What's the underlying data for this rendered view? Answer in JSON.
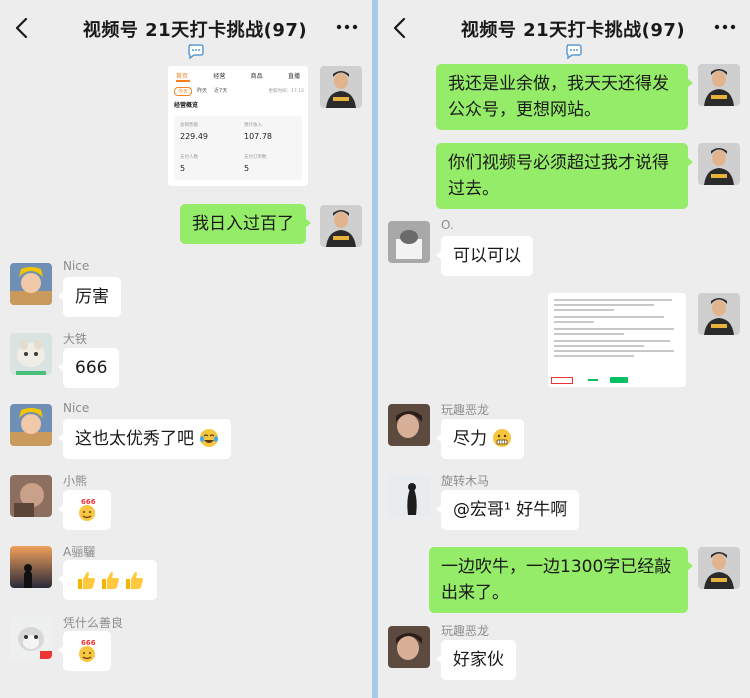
{
  "left_panel": {
    "header": {
      "title": "视频号 21天打卡挑战(97)"
    },
    "dashboard_card": {
      "tabs": [
        "首页",
        "经营",
        "商品",
        "直播"
      ],
      "filters": [
        "今天",
        "昨天",
        "近7天"
      ],
      "update_label": "更新时间：17:12",
      "section_title": "经营概览",
      "metrics": [
        {
          "label": "总销售额",
          "value": "229.49"
        },
        {
          "label": "预计收入",
          "value": "107.78"
        },
        {
          "label": "支付人数",
          "value": "5"
        },
        {
          "label": "支付订单数",
          "value": "5"
        }
      ]
    },
    "messages": [
      {
        "type": "out",
        "text": "我日入过百了"
      },
      {
        "type": "in",
        "nick": "Nice",
        "text": "厉害"
      },
      {
        "type": "in",
        "nick": "大铁",
        "text": "666"
      },
      {
        "type": "in",
        "nick": "Nice",
        "text": "这也太优秀了吧"
      },
      {
        "type": "in",
        "nick": "小熊",
        "text": ""
      },
      {
        "type": "in",
        "nick": "A骊驪",
        "text": ""
      },
      {
        "type": "in",
        "nick": "凭什么善良",
        "text": ""
      }
    ]
  },
  "right_panel": {
    "header": {
      "title": "视频号 21天打卡挑战(97)"
    },
    "messages": [
      {
        "type": "out",
        "text": "我还是业余做，我天天还得发公众号，更想网站。"
      },
      {
        "type": "out",
        "text": "你们视频号必须超过我才说得过去。"
      },
      {
        "type": "in",
        "nick": "O.",
        "text": "可以可以"
      },
      {
        "type": "in",
        "nick": "玩趣恶龙",
        "text": "尽力"
      },
      {
        "type": "in",
        "nick": "旋转木马",
        "text": "@宏哥¹ 好牛啊"
      },
      {
        "type": "out",
        "text": "一边吹牛，一边1300字已经敲出来了。"
      },
      {
        "type": "in",
        "nick": "玩趣恶龙",
        "text": "好家伙"
      }
    ],
    "doc_card": {
      "lines": []
    }
  },
  "colors": {
    "chat_bg": "#ededed",
    "outgoing_bubble": "#95ec69",
    "incoming_bubble": "#ffffff",
    "nickname": "#8c8c8c",
    "accent_orange": "#f5821f",
    "accent_green": "#07c160"
  },
  "icons": [
    "back-arrow-icon",
    "group-chat-icon",
    "more-dots-icon",
    "emoji-tears-of-joy",
    "emoji-666-face",
    "emoji-thumbs-up",
    "emoji-grimace"
  ]
}
